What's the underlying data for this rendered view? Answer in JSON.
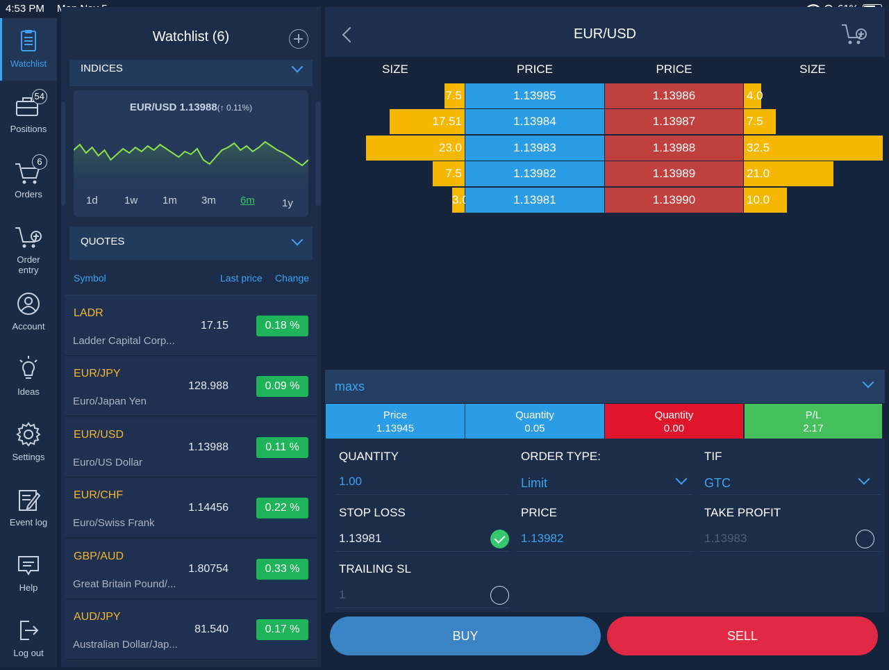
{
  "status": {
    "time": "4:53 PM",
    "date": "Mon Nov 5",
    "battery": "61%"
  },
  "nav": [
    {
      "label": "Watchlist",
      "icon": "clipboard-icon"
    },
    {
      "label": "Positions",
      "icon": "briefcase-icon",
      "badge": "54"
    },
    {
      "label": "Orders",
      "icon": "cart-icon",
      "badge": "6"
    },
    {
      "label": "Order entry",
      "icon": "cart-add-icon"
    },
    {
      "label": "Account",
      "icon": "user-icon"
    },
    {
      "label": "Ideas",
      "icon": "lightbulb-icon"
    },
    {
      "label": "Settings",
      "icon": "gear-icon"
    },
    {
      "label": "Event log",
      "icon": "edit-log-icon"
    },
    {
      "label": "Help",
      "icon": "help-icon"
    },
    {
      "label": "Log out",
      "icon": "logout-icon"
    }
  ],
  "watchlist": {
    "title": "Watchlist (6)",
    "indices_label": "INDICES",
    "chart_title": "EUR/USD 1.13988",
    "chart_change": "(↑ 0.11%)",
    "ranges": [
      "1d",
      "1w",
      "1m",
      "3m",
      "6m",
      "1y"
    ],
    "selected_range": "6m",
    "quotes_label": "QUOTES",
    "col_symbol": "Symbol",
    "col_last": "Last price",
    "col_change": "Change",
    "quotes": [
      {
        "symbol": "LADR",
        "name": "Ladder Capital Corp...",
        "last": "17.15",
        "change": "0.18 %"
      },
      {
        "symbol": "EUR/JPY",
        "name": "Euro/Japan Yen",
        "last": "128.988",
        "change": "0.09 %"
      },
      {
        "symbol": "EUR/USD",
        "name": "Euro/US Dollar",
        "last": "1.13988",
        "change": "0.11 %"
      },
      {
        "symbol": "EUR/CHF",
        "name": "Euro/Swiss Frank",
        "last": "1.14456",
        "change": "0.22 %"
      },
      {
        "symbol": "GBP/AUD",
        "name": "Great Britain Pound/...",
        "last": "1.80754",
        "change": "0.33 %"
      },
      {
        "symbol": "AUD/JPY",
        "name": "Australian Dollar/Jap...",
        "last": "81.540",
        "change": "0.17 %"
      }
    ]
  },
  "detail": {
    "title": "EUR/USD",
    "orderbook_headers": [
      "SIZE",
      "PRICE",
      "PRICE",
      "SIZE"
    ],
    "orderbook": [
      {
        "bid_size": "7.5",
        "bid": "1.13985",
        "ask": "1.13986",
        "ask_size": "4.0",
        "bid_frac": 0.204,
        "ask_frac": 0.123
      },
      {
        "bid_size": "17.51",
        "bid": "1.13984",
        "ask": "1.13987",
        "ask_size": "7.5",
        "bid_frac": 0.76,
        "ask_frac": 0.231
      },
      {
        "bid_size": "23.0",
        "bid": "1.13983",
        "ask": "1.13988",
        "ask_size": "32.5",
        "bid_frac": 1.0,
        "ask_frac": 1.0
      },
      {
        "bid_size": "7.5",
        "bid": "1.13982",
        "ask": "1.13989",
        "ask_size": "21.0",
        "bid_frac": 0.326,
        "ask_frac": 0.646
      },
      {
        "bid_size": "3.0",
        "bid": "1.13981",
        "ask": "1.13990",
        "ask_size": "10.0",
        "bid_frac": 0.13,
        "ask_frac": 0.308
      }
    ],
    "account": "maxs",
    "stats": [
      {
        "label": "Price",
        "value": "1.13945",
        "color": "#2b9de6"
      },
      {
        "label": "Quantity",
        "value": "0.05",
        "color": "#2b9de6"
      },
      {
        "label": "Quantity",
        "value": "0.00",
        "color": "#e0142b"
      },
      {
        "label": "P/L",
        "value": "2.17",
        "color": "#45c05c"
      }
    ],
    "form": {
      "quantity_label": "QUANTITY",
      "quantity": "1.00",
      "order_type_label": "ORDER TYPE:",
      "order_type": "Limit",
      "tif_label": "TIF",
      "tif": "GTC",
      "stop_loss_label": "STOP LOSS",
      "stop_loss": "1.13981",
      "price_label": "PRICE",
      "price": "1.13982",
      "take_profit_label": "TAKE PROFIT",
      "take_profit": "1.13983",
      "trailing_label": "TRAILING SL",
      "trailing": "1"
    },
    "buy_label": "BUY",
    "sell_label": "SELL",
    "buy_color": "#3a84c6",
    "sell_color": "#e02a45"
  }
}
